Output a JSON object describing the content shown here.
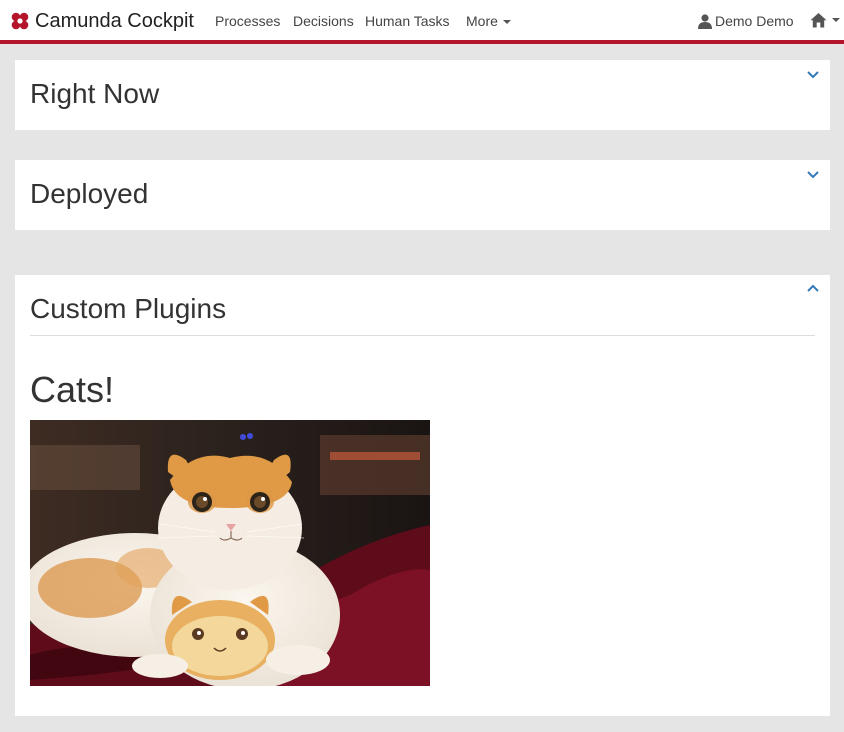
{
  "navbar": {
    "brand": "Camunda Cockpit",
    "links": [
      "Processes",
      "Decisions",
      "Human Tasks",
      "More"
    ],
    "user": "Demo Demo"
  },
  "panels": [
    {
      "title": "Right Now",
      "expanded": false
    },
    {
      "title": "Deployed",
      "expanded": false
    },
    {
      "title": "Custom Plugins",
      "expanded": true
    }
  ],
  "plugin": {
    "heading": "Cats!"
  },
  "colors": {
    "brand_red": "#b5152b",
    "link_blue": "#337ab7",
    "page_bg": "#e5e5e5"
  },
  "icons": {
    "user": "user-icon",
    "home": "home-icon",
    "collapsed": "chevron-down-icon",
    "expanded": "chevron-up-icon"
  }
}
